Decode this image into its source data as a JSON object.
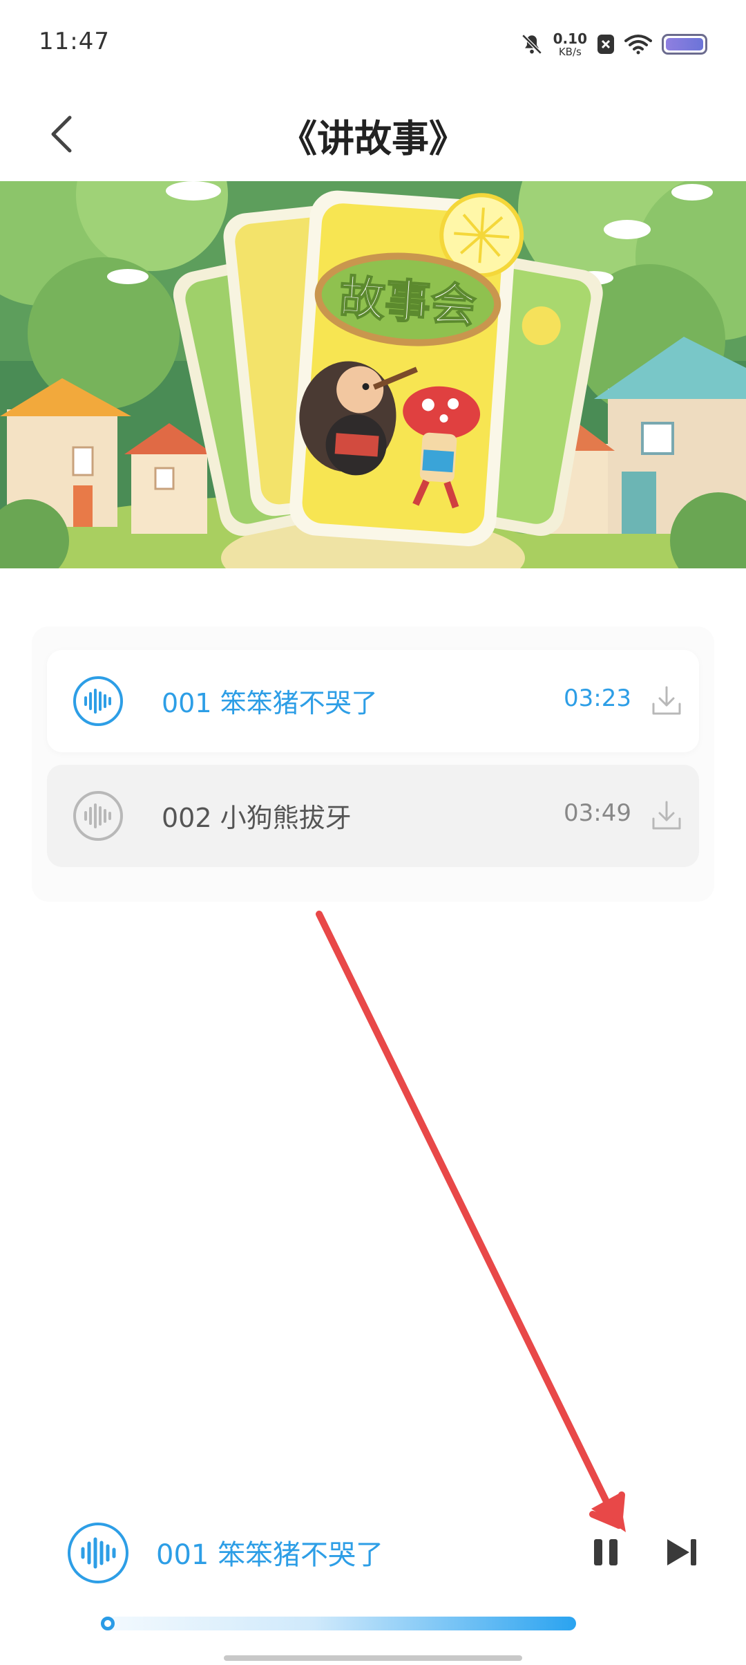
{
  "status_bar": {
    "time": "11:47",
    "net_speed_value": "0.10",
    "net_speed_unit": "KB/s",
    "icons": [
      "bell-muted-icon",
      "sim-blocked-icon",
      "wifi-icon",
      "battery-icon"
    ]
  },
  "header": {
    "title": "《讲故事》",
    "back_icon": "chevron-left-icon"
  },
  "banner": {
    "sign_text": "故事会"
  },
  "playlist": {
    "tracks": [
      {
        "title": "001 笨笨猪不哭了",
        "duration": "03:23",
        "state": "playing"
      },
      {
        "title": "002 小狗熊拔牙",
        "duration": "03:49",
        "state": "idle"
      }
    ]
  },
  "player": {
    "now_playing": "001 笨笨猪不哭了",
    "controls": [
      "pause-icon",
      "next-track-icon"
    ]
  },
  "colors": {
    "accent": "#2d9ee6",
    "inactive_text": "#555555",
    "annotation_arrow": "#e84848"
  }
}
